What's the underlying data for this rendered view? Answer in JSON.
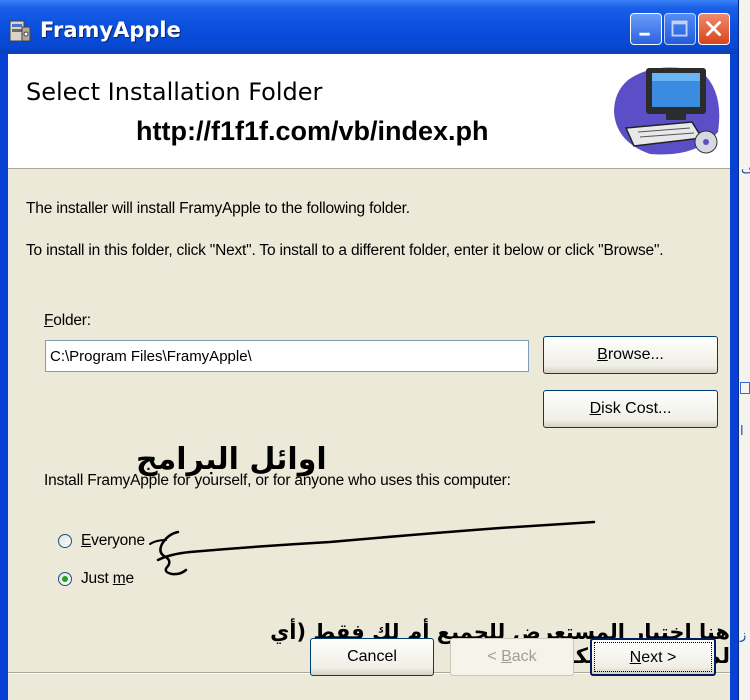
{
  "window": {
    "title": "FramyApple",
    "controls": {
      "minimize_icon": "minimize-icon",
      "maximize_icon": "maximize-icon",
      "close_icon": "close-icon"
    }
  },
  "banner": {
    "title": "Select Installation Folder",
    "overlay_url": "http://f1f1f.com/vb/index.ph",
    "art_icon": "computer-install-icon"
  },
  "body": {
    "intro": "The installer will install FramyApple to the following folder.",
    "instructions": "To install in this folder, click \"Next\". To install to a different folder, enter it below or click \"Browse\".",
    "folder_label_mnemonic": "F",
    "folder_label_rest": "older:",
    "folder_value": "C:\\Program Files\\FramyApple\\",
    "browse_mnemonic": "B",
    "browse_rest": "rowse...",
    "diskcost_mnemonic": "D",
    "diskcost_rest": "isk Cost...",
    "arabic_heading": "اوائل البرامج",
    "install_for": "Install FramyApple for yourself, or for anyone who uses this computer:",
    "radio_everyone_mnemonic": "E",
    "radio_everyone_rest": "veryone",
    "radio_justme_first": "Just ",
    "radio_justme_mnemonic": "m",
    "radio_justme_rest": "e",
    "selected_option": "Just me",
    "arabic_note": "هنا اختيار المستعرض للجميع أم لك فقط (أي لمستخدمين الكمبيوتر )"
  },
  "footer": {
    "cancel_label": "Cancel",
    "back_prefix": "< ",
    "back_mnemonic": "B",
    "back_rest": "ack",
    "next_mnemonic": "N",
    "next_rest": "ext >"
  },
  "colors": {
    "titlebar": "#0a4fde",
    "dialog_bg": "#ece9d8",
    "radio_selected": "#21a121"
  }
}
